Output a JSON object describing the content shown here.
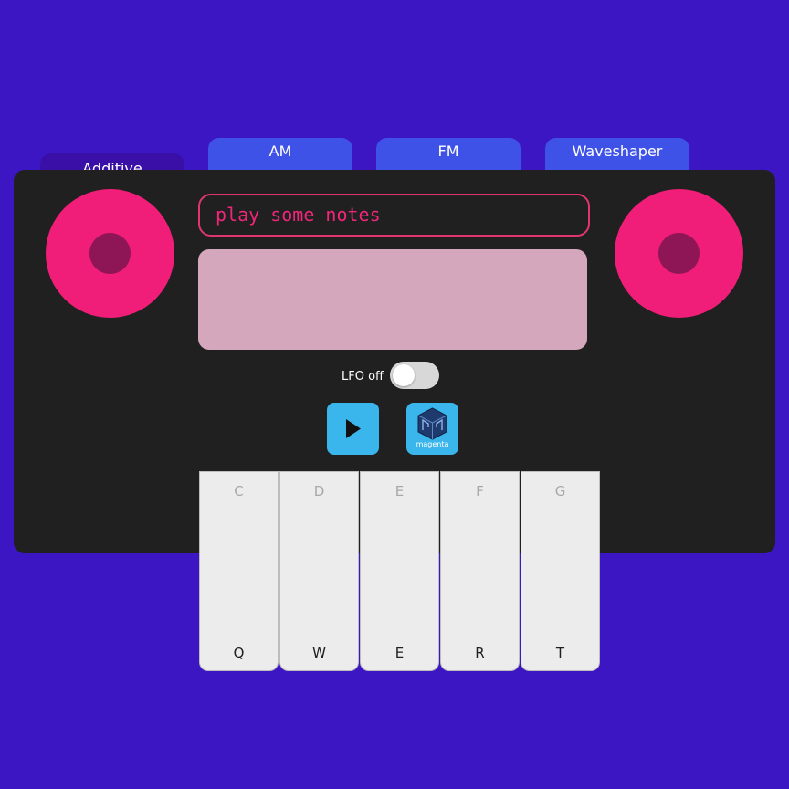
{
  "tabs": [
    {
      "label": "Additive",
      "active": true
    },
    {
      "label": "AM",
      "active": false
    },
    {
      "label": "FM",
      "active": false
    },
    {
      "label": "Waveshaper",
      "active": false
    }
  ],
  "display": {
    "text": "play some notes"
  },
  "lfo": {
    "label": "LFO off",
    "on": false
  },
  "buttons": {
    "play_icon": "play-icon",
    "magenta_label": "magenta"
  },
  "keys": [
    {
      "note": "C",
      "key": "Q"
    },
    {
      "note": "D",
      "key": "W"
    },
    {
      "note": "E",
      "key": "E"
    },
    {
      "note": "F",
      "key": "R"
    },
    {
      "note": "G",
      "key": "T"
    }
  ],
  "colors": {
    "background": "#3d16c4",
    "panel": "#202020",
    "accent_pink": "#f01e78",
    "button_blue": "#3ab6ec",
    "tab_blue": "#3f52e8"
  }
}
